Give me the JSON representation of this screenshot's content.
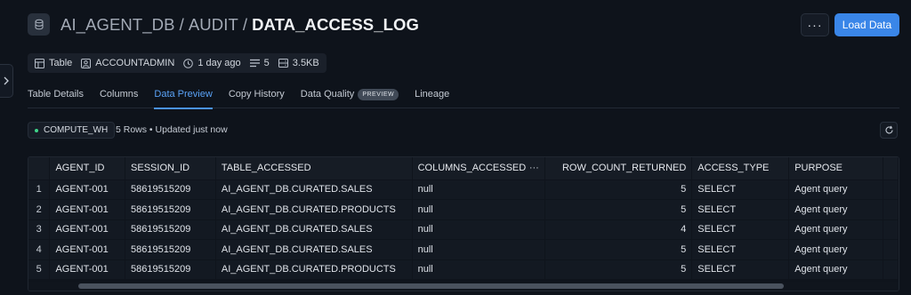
{
  "breadcrumb": {
    "database": "AI_AGENT_DB",
    "schema": "AUDIT",
    "table": "DATA_ACCESS_LOG",
    "separator": "/"
  },
  "actions": {
    "more": "···",
    "load_data": "Load Data"
  },
  "meta": {
    "type": "Table",
    "owner": "ACCOUNTADMIN",
    "updated": "1 day ago",
    "columns_count": "5",
    "size": "3.5KB"
  },
  "tabs": [
    {
      "label": "Table Details"
    },
    {
      "label": "Columns"
    },
    {
      "label": "Data Preview",
      "active": true
    },
    {
      "label": "Copy History"
    },
    {
      "label": "Data Quality",
      "badge": "PREVIEW"
    },
    {
      "label": "Lineage"
    }
  ],
  "toolbar": {
    "warehouse": "COMPUTE_WH",
    "rows_info": "5 Rows • Updated just now"
  },
  "grid": {
    "columns": [
      "AGENT_ID",
      "SESSION_ID",
      "TABLE_ACCESSED",
      "COLUMNS_ACCESSED",
      "ROW_COUNT_RETURNED",
      "ACCESS_TYPE",
      "PURPOSE"
    ],
    "column_menu": "···",
    "rows": [
      {
        "n": "1",
        "cells": [
          "AGENT-001",
          "58619515209",
          "AI_AGENT_DB.CURATED.SALES",
          "null",
          "5",
          "SELECT",
          "Agent query"
        ]
      },
      {
        "n": "2",
        "cells": [
          "AGENT-001",
          "58619515209",
          "AI_AGENT_DB.CURATED.PRODUCTS",
          "null",
          "5",
          "SELECT",
          "Agent query"
        ]
      },
      {
        "n": "3",
        "cells": [
          "AGENT-001",
          "58619515209",
          "AI_AGENT_DB.CURATED.SALES",
          "null",
          "4",
          "SELECT",
          "Agent query"
        ]
      },
      {
        "n": "4",
        "cells": [
          "AGENT-001",
          "58619515209",
          "AI_AGENT_DB.CURATED.SALES",
          "null",
          "5",
          "SELECT",
          "Agent query"
        ]
      },
      {
        "n": "5",
        "cells": [
          "AGENT-001",
          "58619515209",
          "AI_AGENT_DB.CURATED.PRODUCTS",
          "null",
          "5",
          "SELECT",
          "Agent query"
        ]
      }
    ]
  },
  "colors": {
    "accent": "#3a86e8",
    "active_tab": "#5aa2f6",
    "warehouse_dot": "#3fd58a",
    "background": "#0e131b"
  }
}
